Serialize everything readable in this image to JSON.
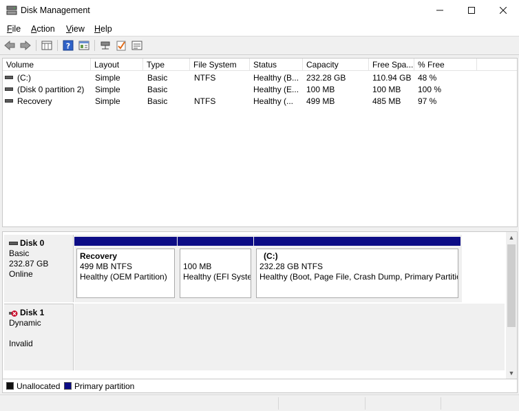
{
  "window": {
    "title": "Disk Management"
  },
  "menu": [
    {
      "first": "F",
      "rest": "ile"
    },
    {
      "first": "A",
      "rest": "ction"
    },
    {
      "first": "V",
      "rest": "iew"
    },
    {
      "first": "H",
      "rest": "elp"
    }
  ],
  "toolbar": {
    "icons": [
      "back-arrow-icon",
      "forward-arrow-icon",
      "disk-list-icon",
      "help-icon",
      "properties-icon",
      "connect-icon",
      "check-icon",
      "settings-list-icon"
    ]
  },
  "volume_list": {
    "columns": [
      "Volume",
      "Layout",
      "Type",
      "File System",
      "Status",
      "Capacity",
      "Free Spa...",
      "% Free"
    ],
    "rows": [
      {
        "volume": "(C:)",
        "layout": "Simple",
        "type": "Basic",
        "fs": "NTFS",
        "status": "Healthy (B...",
        "capacity": "232.28 GB",
        "free": "110.94 GB",
        "pct": "48 %"
      },
      {
        "volume": "(Disk 0 partition 2)",
        "layout": "Simple",
        "type": "Basic",
        "fs": "",
        "status": "Healthy (E...",
        "capacity": "100 MB",
        "free": "100 MB",
        "pct": "100 %"
      },
      {
        "volume": "Recovery",
        "layout": "Simple",
        "type": "Basic",
        "fs": "NTFS",
        "status": "Healthy (...",
        "capacity": "499 MB",
        "free": "485 MB",
        "pct": "97 %"
      }
    ]
  },
  "disks": [
    {
      "name": "Disk 0",
      "type": "Basic",
      "size": "232.87 GB",
      "state": "Online",
      "partitions": [
        {
          "title": "Recovery",
          "size": "499 MB NTFS",
          "status": "Healthy (OEM Partition)"
        },
        {
          "title": "",
          "size": "100 MB",
          "status": "Healthy (EFI System Partition)"
        },
        {
          "title": "(C:)",
          "size": "232.28 GB NTFS",
          "status": "Healthy (Boot, Page File, Crash Dump, Primary Partition)"
        }
      ]
    },
    {
      "name": "Disk 1",
      "type": "Dynamic",
      "size": "",
      "state": "Invalid"
    }
  ],
  "legend": [
    {
      "label": "Unallocated",
      "color": "#111111"
    },
    {
      "label": "Primary partition",
      "color": "#0c0c85"
    }
  ]
}
